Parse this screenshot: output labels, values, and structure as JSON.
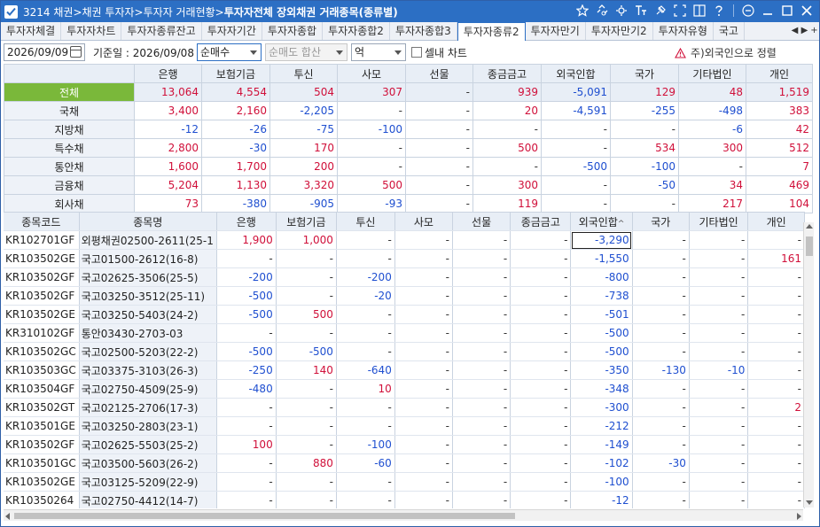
{
  "window": {
    "screen_no": "3214",
    "path": "채권>채권 투자자>투자자 거래현황>",
    "title_bold": "투자자전체 장외채권 거래종목(종류별)"
  },
  "title_icons": [
    "star-icon",
    "link-icon",
    "gear-icon",
    "text-size-icon",
    "pin-icon",
    "capture-icon",
    "split-icon",
    "help-icon",
    "minimize-icon",
    "maximize-icon",
    "close-icon"
  ],
  "tabs": [
    {
      "label": "투자자체결",
      "active": false
    },
    {
      "label": "투자자차트",
      "active": false
    },
    {
      "label": "투자자종류잔고",
      "active": false
    },
    {
      "label": "투자자기간",
      "active": false
    },
    {
      "label": "투자자종합",
      "active": false
    },
    {
      "label": "투자자종합2",
      "active": false
    },
    {
      "label": "투자자종합3",
      "active": false
    },
    {
      "label": "투자자종류2",
      "active": true
    },
    {
      "label": "투자자만기",
      "active": false
    },
    {
      "label": "투자자만기2",
      "active": false
    },
    {
      "label": "투자자유형",
      "active": false
    },
    {
      "label": "국고",
      "active": false
    }
  ],
  "tab_nav": {
    "prev": "◀",
    "next": "▶",
    "add": "+"
  },
  "toolbar": {
    "date": "2026/09/09",
    "base_date_label": "기준일 : 2026/09/08",
    "mode_select": "순매수",
    "sum_select": "순매도 합산",
    "unit_select": "억",
    "cell_checkbox_label": "셀내 차트",
    "note": "주)외국인으로 정렬"
  },
  "summary": {
    "columns": [
      "은행",
      "보험기금",
      "투신",
      "사모",
      "선물",
      "종금금고",
      "외국인합",
      "국가",
      "기타법인",
      "개인"
    ],
    "rows": [
      {
        "label": "전체",
        "values": [
          "13,064",
          "4,554",
          "504",
          "307",
          "-",
          "939",
          "-5,091",
          "129",
          "48",
          "1,519"
        ]
      },
      {
        "label": "국채",
        "values": [
          "3,400",
          "2,160",
          "-2,205",
          "-",
          "-",
          "20",
          "-4,591",
          "-255",
          "-498",
          "383"
        ]
      },
      {
        "label": "지방채",
        "values": [
          "-12",
          "-26",
          "-75",
          "-100",
          "-",
          "-",
          "-",
          "-",
          "-6",
          "42"
        ]
      },
      {
        "label": "특수채",
        "values": [
          "2,800",
          "-30",
          "170",
          "-",
          "-",
          "500",
          "-",
          "534",
          "300",
          "512"
        ]
      },
      {
        "label": "통안채",
        "values": [
          "1,600",
          "1,700",
          "200",
          "-",
          "-",
          "-",
          "-500",
          "-100",
          "-",
          "7"
        ]
      },
      {
        "label": "금융채",
        "values": [
          "5,204",
          "1,130",
          "3,320",
          "500",
          "-",
          "300",
          "-",
          "-50",
          "34",
          "469"
        ]
      },
      {
        "label": "회사채",
        "values": [
          "73",
          "-380",
          "-905",
          "-93",
          "-",
          "119",
          "-",
          "-",
          "217",
          "104"
        ]
      }
    ]
  },
  "detail": {
    "columns": [
      "종목코드",
      "종목명",
      "은행",
      "보험기금",
      "투신",
      "사모",
      "선물",
      "종금금고",
      "외국인합",
      "국가",
      "기타법인",
      "개인"
    ],
    "sort_indicator": "^",
    "rows": [
      {
        "code": "KR102701GF",
        "name": "외평채권02500-2611(25-1",
        "values": [
          "1,900",
          "1,000",
          "-",
          "-",
          "-",
          "-",
          "-3,290",
          "-",
          "-",
          "-"
        ]
      },
      {
        "code": "KR103502GE",
        "name": "국고01500-2612(16-8)",
        "values": [
          "-",
          "-",
          "-",
          "-",
          "-",
          "-",
          "-1,550",
          "-",
          "-",
          "161"
        ]
      },
      {
        "code": "KR103502GF",
        "name": "국고02625-3506(25-5)",
        "values": [
          "-200",
          "-",
          "-200",
          "-",
          "-",
          "-",
          "-800",
          "-",
          "-",
          "-"
        ]
      },
      {
        "code": "KR103502GF",
        "name": "국고03250-3512(25-11)",
        "values": [
          "-500",
          "-",
          "-20",
          "-",
          "-",
          "-",
          "-738",
          "-",
          "-",
          "-"
        ]
      },
      {
        "code": "KR103502GE",
        "name": "국고03250-5403(24-2)",
        "values": [
          "-500",
          "500",
          "-",
          "-",
          "-",
          "-",
          "-501",
          "-",
          "-",
          "-"
        ]
      },
      {
        "code": "KR310102GF",
        "name": "통안03430-2703-03",
        "values": [
          "-",
          "-",
          "-",
          "-",
          "-",
          "-",
          "-500",
          "-",
          "-",
          "-"
        ]
      },
      {
        "code": "KR103502GC",
        "name": "국고02500-5203(22-2)",
        "values": [
          "-500",
          "-500",
          "-",
          "-",
          "-",
          "-",
          "-500",
          "-",
          "-",
          "-"
        ]
      },
      {
        "code": "KR103503GC",
        "name": "국고03375-3103(26-3)",
        "values": [
          "-250",
          "140",
          "-640",
          "-",
          "-",
          "-",
          "-350",
          "-130",
          "-10",
          "-"
        ]
      },
      {
        "code": "KR103504GF",
        "name": "국고02750-4509(25-9)",
        "values": [
          "-480",
          "-",
          "10",
          "-",
          "-",
          "-",
          "-348",
          "-",
          "-",
          "-"
        ]
      },
      {
        "code": "KR103502GT",
        "name": "국고02125-2706(17-3)",
        "values": [
          "-",
          "-",
          "-",
          "-",
          "-",
          "-",
          "-300",
          "-",
          "-",
          "2"
        ]
      },
      {
        "code": "KR103501GE",
        "name": "국고03250-2803(23-1)",
        "values": [
          "-",
          "-",
          "-",
          "-",
          "-",
          "-",
          "-212",
          "-",
          "-",
          "-"
        ]
      },
      {
        "code": "KR103502GF",
        "name": "국고02625-5503(25-2)",
        "values": [
          "100",
          "-",
          "-100",
          "-",
          "-",
          "-",
          "-149",
          "-",
          "-",
          "-"
        ]
      },
      {
        "code": "KR103501GC",
        "name": "국고03500-5603(26-2)",
        "values": [
          "-",
          "880",
          "-60",
          "-",
          "-",
          "-",
          "-102",
          "-30",
          "-",
          "-"
        ]
      },
      {
        "code": "KR103502GE",
        "name": "국고03125-5209(22-9)",
        "values": [
          "-",
          "-",
          "-",
          "-",
          "-",
          "-",
          "-100",
          "-",
          "-",
          "-"
        ]
      },
      {
        "code": "KR10350264",
        "name": "국고02750-4412(14-7)",
        "values": [
          "-",
          "-",
          "-",
          "-",
          "-",
          "-",
          "-12",
          "-",
          "-",
          "-"
        ]
      }
    ]
  },
  "colors": {
    "titlebar": "#2c6fc4",
    "positive": "#d0103a",
    "negative": "#1f4fd0",
    "selected_row": "#7ab83a"
  }
}
